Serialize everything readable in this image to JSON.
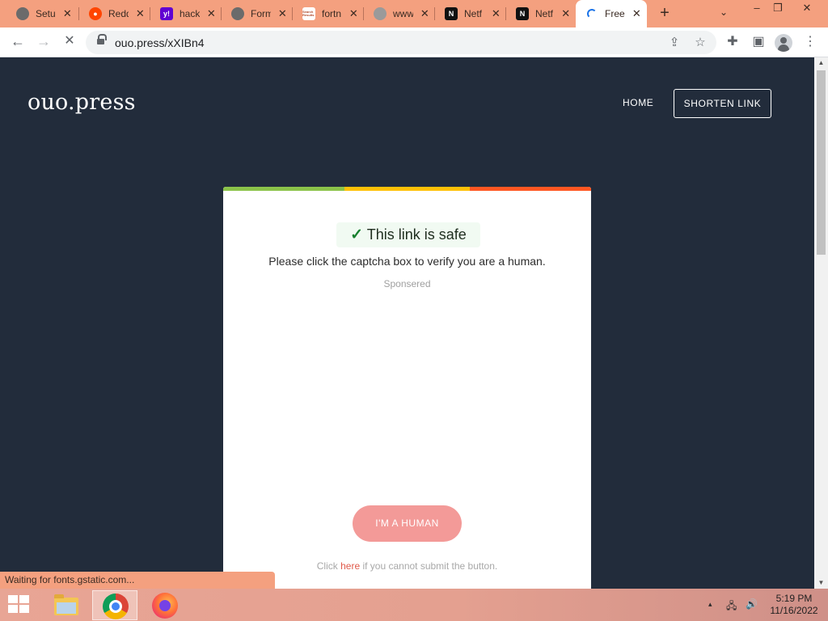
{
  "browser": {
    "tabs": [
      {
        "title": "Setu",
        "favicon": "globe-icon",
        "favicon_color": "#6b6b6b"
      },
      {
        "title": "Redd",
        "favicon": "reddit-icon",
        "favicon_color": "#ff4500"
      },
      {
        "title": "hack",
        "favicon": "yahoo-icon",
        "favicon_color": "#6001d2"
      },
      {
        "title": "Form",
        "favicon": "globe-icon",
        "favicon_color": "#6b6b6b"
      },
      {
        "title": "fortn",
        "favicon": "search-results-icon",
        "favicon_color": "#b04a2c"
      },
      {
        "title": "www.",
        "favicon": "globe-icon",
        "favicon_color": "#9a9a9a"
      },
      {
        "title": "Netf",
        "favicon": "notion-icon",
        "favicon_color": "#111111"
      },
      {
        "title": "Netf",
        "favicon": "notion-icon",
        "favicon_color": "#111111"
      },
      {
        "title": "Free",
        "favicon": "loading-spinner-icon",
        "favicon_color": "#1a73e8",
        "active": true
      }
    ],
    "favicon_glyphs": {
      "reddit": "●",
      "yahoo": "y!",
      "notion": "N",
      "search": "Search Results"
    },
    "new_tab_glyph": "+",
    "tab_close_glyph": "✕",
    "tab_list_glyph": "⌄",
    "window_controls": {
      "minimize": "–",
      "restore": "❐",
      "close": "✕"
    },
    "nav": {
      "back": "←",
      "forward": "→",
      "stop": "✕"
    },
    "url": "ouo.press/xXIBn4",
    "icons": {
      "share": "⇪",
      "star": "☆",
      "extensions": "✚",
      "sidepanel": "▣",
      "menu": "⋮"
    },
    "status_text": "Waiting for fonts.gstatic.com..."
  },
  "page": {
    "logo": "ouo.press",
    "nav": {
      "home": "HOME",
      "shorten": "SHORTEN LINK"
    },
    "card": {
      "stripe_colors": [
        "#8bc34a",
        "#ffc107",
        "#ff5722"
      ],
      "check_glyph": "✓",
      "safe_text": "This link is safe",
      "instruction": "Please click the captcha box to verify you are a human.",
      "sponsored": "Sponsered",
      "human_button": "I'M A HUMAN",
      "fallback_prefix": "Click ",
      "fallback_link": "here",
      "fallback_suffix": " if you cannot submit the button."
    }
  },
  "taskbar": {
    "apps": [
      "file-explorer",
      "chrome",
      "firefox"
    ],
    "tray": {
      "chevron": "▴",
      "network": "🖧",
      "volume": "🔊"
    },
    "clock": {
      "time": "5:19 PM",
      "date": "11/16/2022"
    }
  },
  "scrollbar": {
    "up": "▲",
    "down": "▼"
  }
}
